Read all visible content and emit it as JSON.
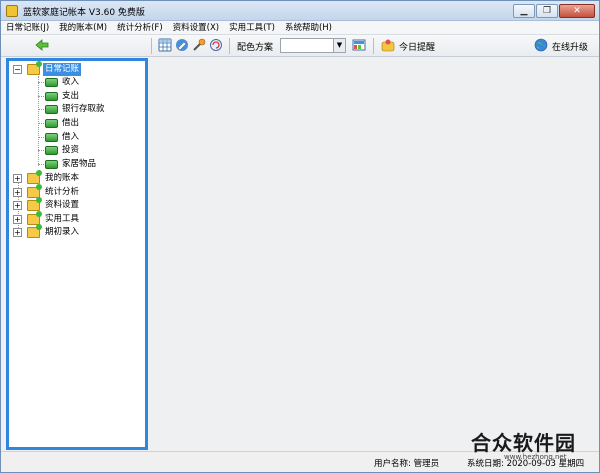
{
  "window": {
    "title": "蓝软家庭记帐本 V3.60  免费版",
    "minimize": "▁",
    "restore": "❐",
    "close": "✕"
  },
  "menu": [
    "日常记账(J)",
    "我的账本(M)",
    "统计分析(F)",
    "资料设置(X)",
    "实用工具(T)",
    "系统帮助(H)"
  ],
  "toolbar": {
    "color_scheme_label": "配色方案",
    "color_scheme_value": "",
    "today_reminder": "今日提醒",
    "online_upgrade": "在线升级",
    "icons": [
      "back-arrow-icon",
      "table-icon",
      "edit-icon",
      "tools-icon",
      "refresh-icon",
      "palette-icon",
      "reminder-icon",
      "globe-icon"
    ]
  },
  "tree": {
    "root": "日常记账",
    "children": [
      "收入",
      "支出",
      "银行存取款",
      "借出",
      "借入",
      "投资",
      "家居物品"
    ],
    "other_roots": [
      "我的账本",
      "统计分析",
      "资料设置",
      "实用工具",
      "期初录入"
    ],
    "expand_symbol": "+",
    "collapse_symbol": "−"
  },
  "status": {
    "user": "用户名称: 管理员",
    "date": "系统日期: 2020-09-03  星期四"
  },
  "watermark": {
    "text": "合众软件园",
    "url": "www.hezhong.net"
  },
  "colors": {
    "panel_border": "#2e86e0",
    "selected": "#3b8fe3",
    "leaf": "#2e9a2e",
    "folder": "#f7c948"
  }
}
